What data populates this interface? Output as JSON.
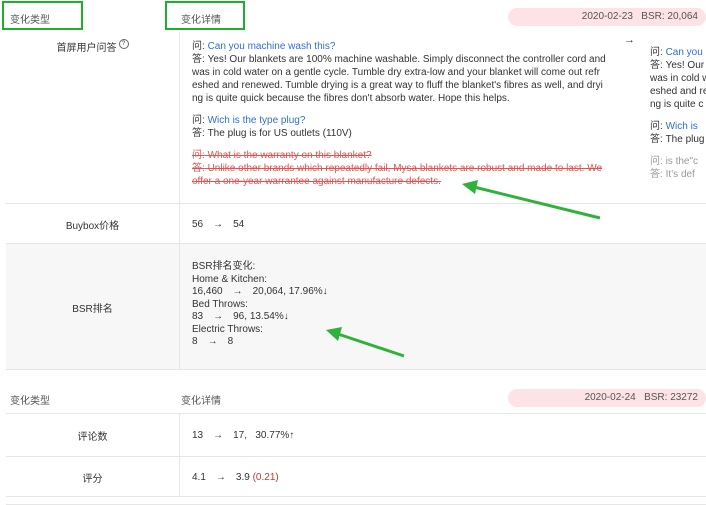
{
  "header1": {
    "type_label": "变化类型",
    "detail_label": "变化详情",
    "date": "2020-02-23",
    "bsr_label": "BSR:",
    "bsr_value": "20,064"
  },
  "qa_row": {
    "label": "首屏用户问答",
    "help_icon": "question-circle-icon",
    "items": [
      {
        "q_prefix": "问:",
        "q": "Can you machine wash this?",
        "a_prefix": "答:",
        "a_lines": [
          "Yes! Our blankets are 100% machine washable. Simply disconnect the controller cord and",
          "was in cold water on a gentle cycle. Tumble dry extra-low and your blanket will come out refr",
          "eshed and renewed. Tumble drying is a great way to fluff the blanket's fibres as well, and dryi",
          "ng is quite quick because the fibres don't absorb water. Hope this helps."
        ]
      },
      {
        "q_prefix": "问:",
        "q": "Wich is the type plug?",
        "a_prefix": "答:",
        "a_lines": [
          "The plug is for US outlets (110V)"
        ]
      }
    ],
    "removed": {
      "q_prefix": "问:",
      "q": "What is the warranty on this blanket?",
      "a_prefix": "答:",
      "a_lines": [
        "Unlike other brands which repeatedly fail, Mysa blankets are robust and made to last. We",
        "offer a one-year warrantee against manufacture defects."
      ]
    },
    "right": {
      "arrow": "→",
      "items": [
        {
          "q_prefix": "问:",
          "q": "Can you",
          "a_prefix": "答:",
          "a_lines": [
            "Yes! Our",
            "was in cold w",
            "eshed and re",
            "ng is quite c"
          ]
        },
        {
          "q_prefix": "问:",
          "q": "Wich is",
          "a_prefix": "答:",
          "a_lines": [
            "The plug"
          ]
        },
        {
          "q_prefix": "问:",
          "q": "is the\"c",
          "a_prefix": "答:",
          "a_lines": [
            "It’s def"
          ]
        }
      ]
    }
  },
  "buybox_row": {
    "label": "Buybox价格",
    "from": "56",
    "arrow": "→",
    "to": "54"
  },
  "bsr_row": {
    "label": "BSR排名",
    "title": "BSR排名变化:",
    "groups": [
      {
        "category": "Home & Kitchen:",
        "from": "16,460",
        "arrow": "→",
        "to": "20,064",
        "change": "17.96%↓"
      },
      {
        "category": "Bed Throws:",
        "from": "83",
        "arrow": "→",
        "to": "96",
        "change": "13.54%↓"
      },
      {
        "category": "Electric Throws:",
        "from": "8",
        "arrow": "→",
        "to": "8",
        "change": ""
      }
    ]
  },
  "header2": {
    "type_label": "变化类型",
    "detail_label": "变化详情",
    "date": "2020-02-24",
    "bsr_label": "BSR:",
    "bsr_value": "23272"
  },
  "reviews_row": {
    "label": "评论数",
    "from": "13",
    "arrow": "→",
    "to": "17,",
    "change": "30.77%↑"
  },
  "rating_row": {
    "label": "评分",
    "from": "4.1",
    "arrow": "→",
    "to": "3.9",
    "change": "(0.21)"
  },
  "colors": {
    "accent_green": "#1fae30",
    "pill_bg": "#fde3e6",
    "link_blue": "#2f6fd6",
    "strike_red": "#e25252",
    "neg_red": "#c0392b"
  }
}
